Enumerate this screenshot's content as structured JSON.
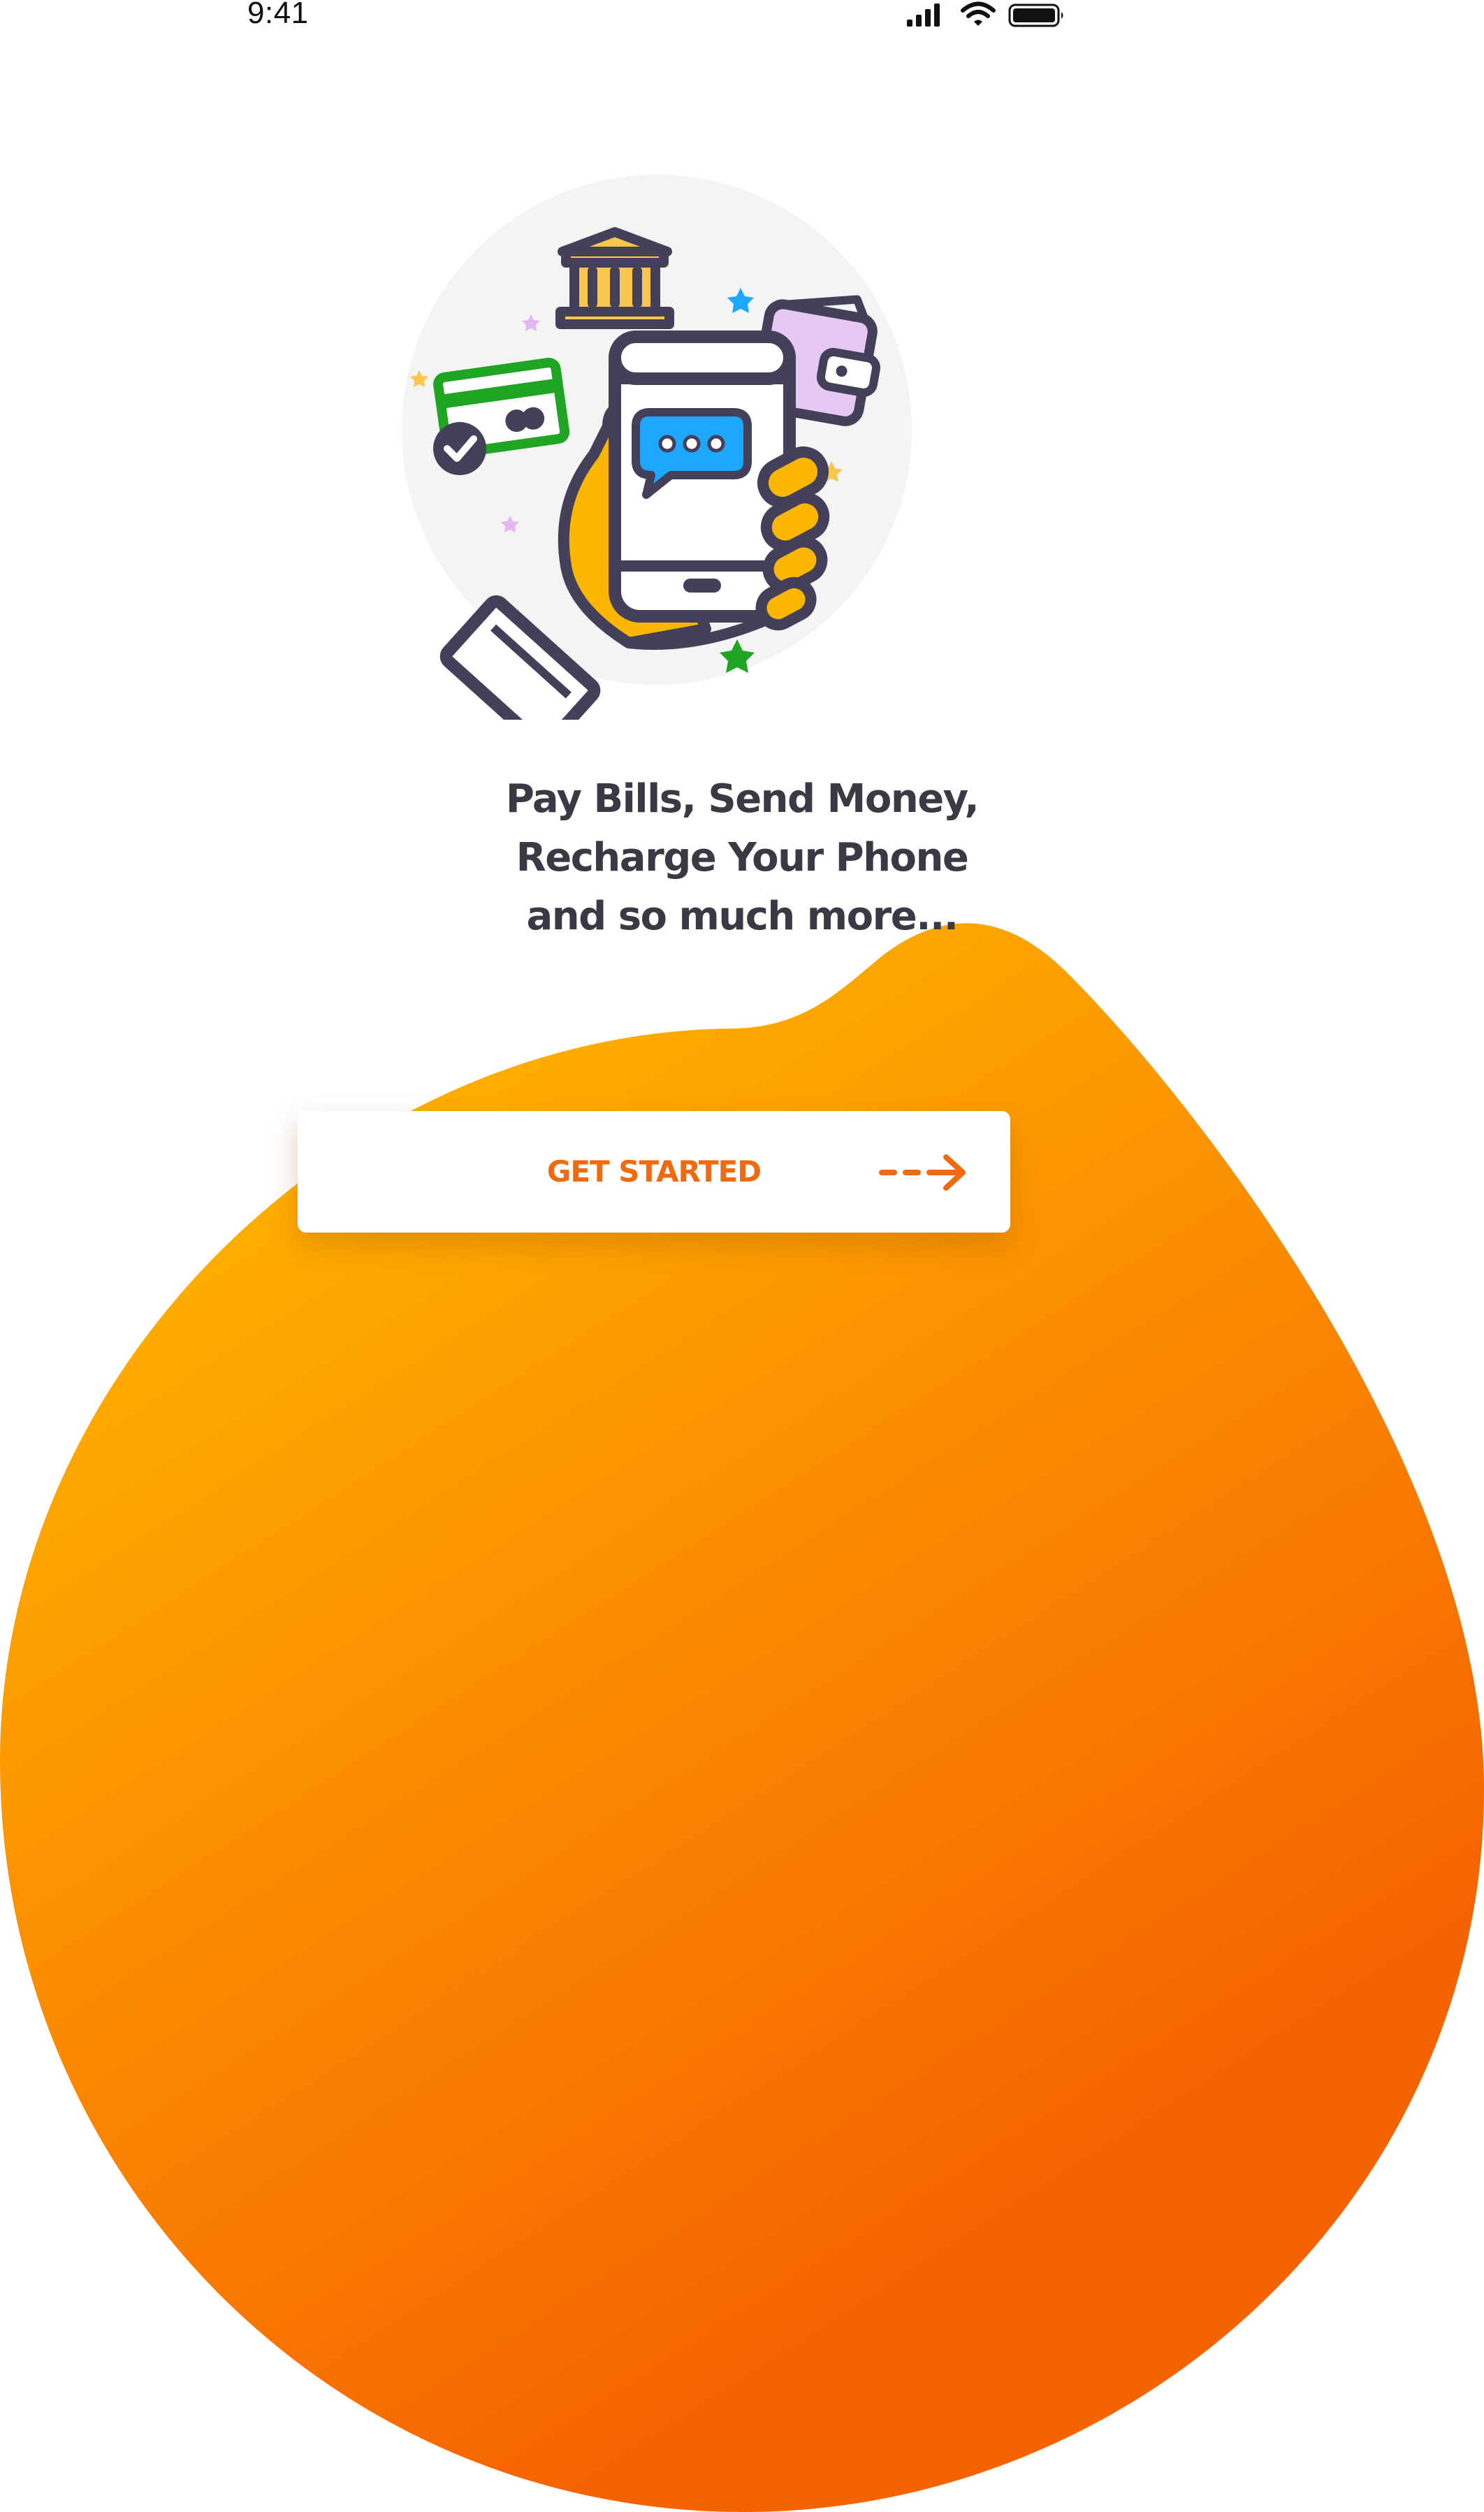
{
  "status_bar": {
    "time": "9:41",
    "icons": [
      "signal-icon",
      "wifi-icon",
      "battery-icon"
    ]
  },
  "hero": {
    "illustration": "hand-holding-phone-with-bills-icon",
    "headline_lines": [
      "Pay Bills, Send Money,",
      "Recharge Your Phone",
      "and so much more..."
    ]
  },
  "cta": {
    "label": "GET STARTED",
    "icon": "dashed-arrow-right-icon"
  },
  "colors": {
    "accent": "#f06a0f",
    "blob_top": "#ffb400",
    "blob_bottom": "#f56300",
    "text": "#3b3a44",
    "illustration_outline": "#44405a",
    "card_green": "#1fa424",
    "wallet_purple": "#e6c8f5",
    "chat_blue": "#1ea7ff"
  }
}
